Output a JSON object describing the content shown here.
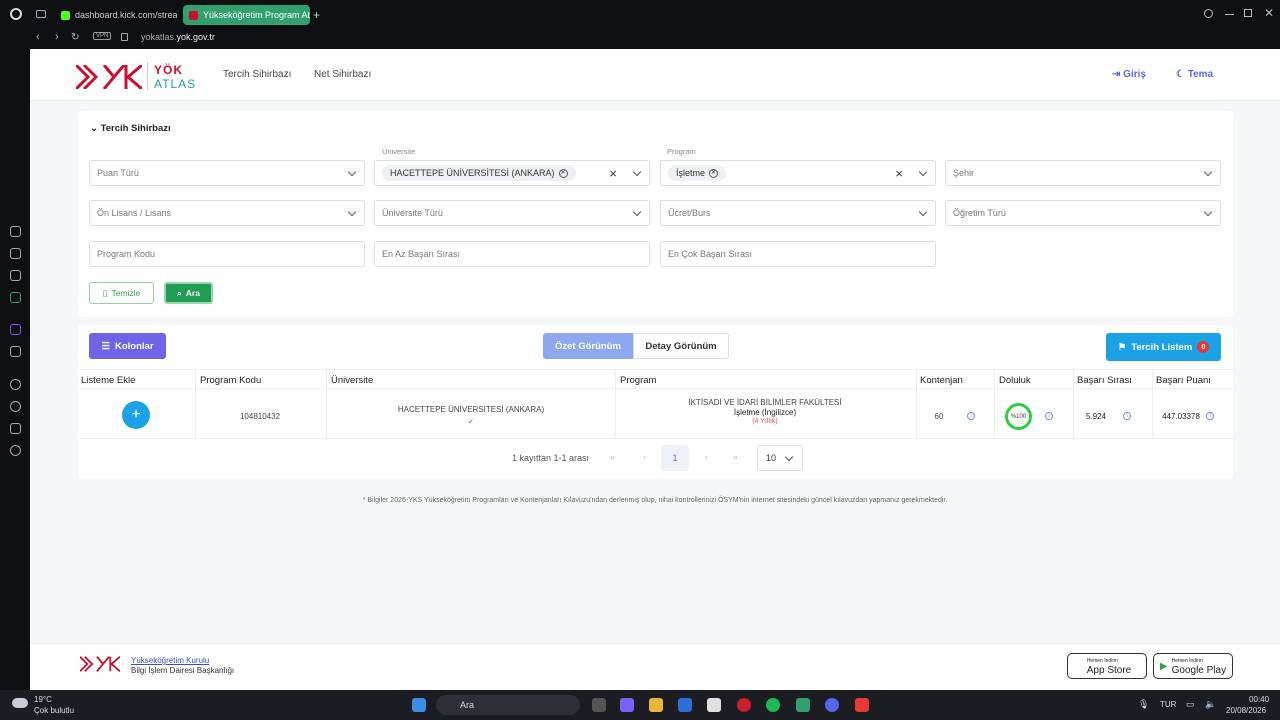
{
  "browser": {
    "tab1": "dashboard.kick.com/strean",
    "tab2": "Yükseköğretim Program Atl",
    "url_prefix": "yokatlas.",
    "url_domain": "yok.gov.tr",
    "vpn": "VPN"
  },
  "header": {
    "logo_top": "YÖK",
    "logo_bottom": "ATLAS",
    "nav": [
      "Tercih Sihirbazı",
      "Net Sihirbazı"
    ],
    "login": "Giriş",
    "theme": "Tema"
  },
  "filters": {
    "section_title": "Tercih Sihirbazı",
    "puan_turu": "Puan Türü",
    "universite_label": "Üniversite",
    "universite_value": "HACETTEPE ÜNİVERSİTESİ (ANKARA)",
    "program_label": "Program",
    "program_value": "İşletme",
    "sehir": "Şehir",
    "onlisans": "Ön Lisans / Lisans",
    "univ_turu": "Üniversite Türü",
    "ucret": "Ücret/Burs",
    "ogretim": "Öğretim Türü",
    "program_kodu": "Program Kodu",
    "en_az": "En Az Başarı Sırası",
    "en_cok": "En Çok Başarı Sırası",
    "btn_clear": "Temizle",
    "btn_search": "Ara"
  },
  "results": {
    "btn_columns": "Kolonlar",
    "view_summary": "Özet Görünüm",
    "view_detail": "Detay Görünüm",
    "my_list": "Tercih Listem",
    "my_list_count": "0",
    "headers": [
      "Listeme Ekle",
      "Program Kodu",
      "Üniversite",
      "Program",
      "Kontenjan",
      "Doluluk",
      "Başarı Sırası",
      "Başarı Puanı"
    ],
    "row": {
      "code": "104810432",
      "university": "HACETTEPE ÜNİVERSİTESİ (ANKARA)",
      "faculty": "İKTİSADİ VE İDARİ BİLİMLER FAKÜLTESİ",
      "program": "İşletme (İngilizce)",
      "duration": "(4 Yıllık)",
      "quota": "60",
      "fill": "%100",
      "rank": "5.924",
      "score": "447.03378"
    },
    "pager_info": "1 kayıttan 1-1 arası",
    "page": "1",
    "page_size": "10"
  },
  "note": "* Bilgiler 2026-YKS Yükseköğretim Programları ve Kontenjanları Kılavuzu'ndan derlenmiş olup, nihai kontrollerinizi ÖSYM'nin internet sitesindeki güncel kılavuzdan yapmanız gerekmektedir.",
  "footer": {
    "link": "Yükseköğretim Kurulu",
    "sub": "Bilgi İşlem Dairesi Başkanlığı",
    "appstore": "App Store",
    "appstore_small": "Hemen İndirin",
    "gplay": "Google Play",
    "gplay_small": "Hemen İndirin"
  },
  "taskbar": {
    "temp": "19°C",
    "weather": "Çok bulutlu",
    "search": "Ara",
    "lang": "TUR",
    "time": "00:40",
    "date": "20/08/2026"
  },
  "colors": {
    "accent_green": "#1f9d55",
    "accent_blue": "#1aa1e6",
    "accent_purple": "#6f63e8",
    "brand_red": "#c8102e",
    "opera_tab": "#2fa06e"
  }
}
